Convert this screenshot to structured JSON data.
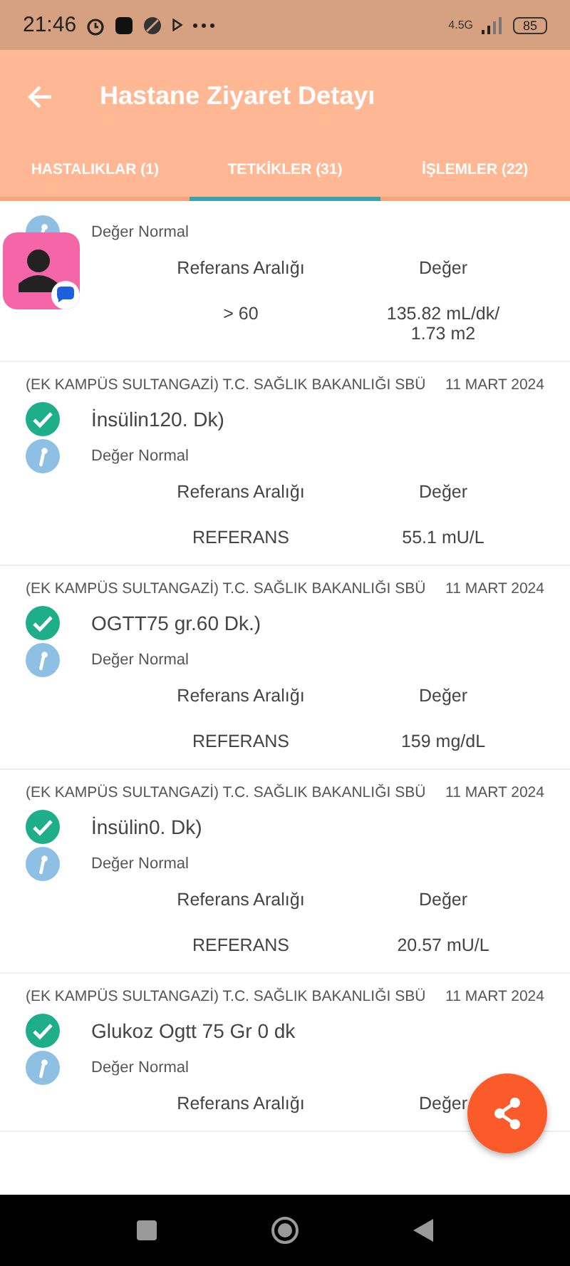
{
  "status_bar": {
    "time": "21:46",
    "battery": "85",
    "network": "4.5G"
  },
  "app_bar": {
    "title": "Hastane Ziyaret Detayı"
  },
  "tabs": [
    {
      "label": "HASTALIKLAR (1)",
      "selected": false
    },
    {
      "label": "TETKİKLER (31)",
      "selected": true
    },
    {
      "label": "İŞLEMLER (22)",
      "selected": false
    }
  ],
  "results": [
    {
      "note": "Değer Normal",
      "range_label": "Referans Aralığı",
      "value_label": "Değer",
      "range": "> 60",
      "value": "135.82 mL/dk/\n1.73 m2"
    },
    {
      "source": "(EK KAMPÜS SULTANGAZİ) T.C. SAĞLIK BAKANLIĞI SBÜ",
      "date": "11 MART 2024",
      "title": "İnsülin120. Dk)",
      "normal": true,
      "note": "Değer Normal",
      "range_label": "Referans Aralığı",
      "value_label": "Değer",
      "range": "REFERANS",
      "value": "55.1 mU/L"
    },
    {
      "source": "(EK KAMPÜS SULTANGAZİ) T.C. SAĞLIK BAKANLIĞI SBÜ",
      "date": "11 MART 2024",
      "title": "OGTT75 gr.60 Dk.)",
      "normal": true,
      "note": "Değer Normal",
      "range_label": "Referans Aralığı",
      "value_label": "Değer",
      "range": "REFERANS",
      "value": "159 mg/dL"
    },
    {
      "source": "(EK KAMPÜS SULTANGAZİ) T.C. SAĞLIK BAKANLIĞI SBÜ",
      "date": "11 MART 2024",
      "title": "İnsülin0. Dk)",
      "normal": true,
      "note": "Değer Normal",
      "range_label": "Referans Aralığı",
      "value_label": "Değer",
      "range": "REFERANS",
      "value": "20.57 mU/L"
    },
    {
      "source": "(EK KAMPÜS SULTANGAZİ) T.C. SAĞLIK BAKANLIĞI SBÜ",
      "date": "11 MART 2024",
      "title": "Glukoz Ogtt 75 Gr 0 dk",
      "normal": true,
      "note": "Değer Normal",
      "range_label": "Referans Aralığı",
      "value_label": "Değer"
    }
  ]
}
